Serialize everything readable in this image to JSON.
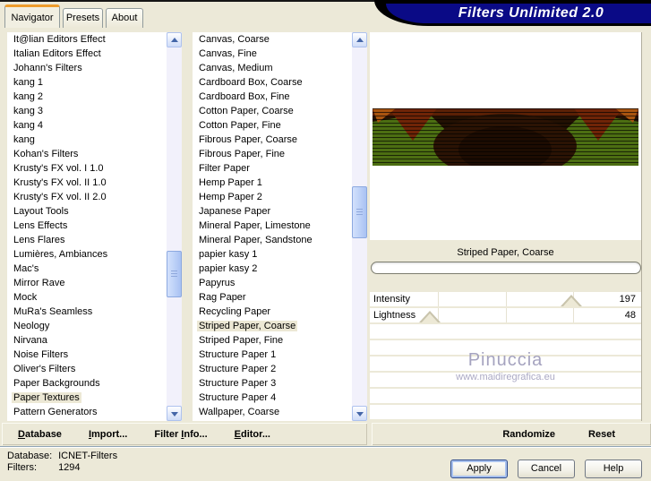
{
  "window": {
    "banner_title": "Filters Unlimited 2.0"
  },
  "tabs": [
    {
      "label": "Navigator",
      "active": true
    },
    {
      "label": "Presets",
      "active": false
    },
    {
      "label": "About",
      "active": false
    }
  ],
  "category_list": {
    "selected": "Paper Textures",
    "items": [
      "It@lian Editors Effect",
      "Italian Editors Effect",
      "Johann's Filters",
      "kang 1",
      "kang 2",
      "kang 3",
      "kang 4",
      "kang",
      "Kohan's Filters",
      "Krusty's FX vol. I 1.0",
      "Krusty's FX vol. II 1.0",
      "Krusty's FX vol. II 2.0",
      "Layout Tools",
      "Lens Effects",
      "Lens Flares",
      "Lumières, Ambiances",
      "Mac's",
      "Mirror Rave",
      "Mock",
      "MuRa's Seamless",
      "Neology",
      "Nirvana",
      "Noise Filters",
      "Oliver's Filters",
      "Paper Backgrounds",
      "Paper Textures",
      "Pattern Generators"
    ]
  },
  "filter_list": {
    "selected": "Striped Paper, Coarse",
    "items": [
      "Canvas, Coarse",
      "Canvas, Fine",
      "Canvas, Medium",
      "Cardboard Box, Coarse",
      "Cardboard Box, Fine",
      "Cotton Paper, Coarse",
      "Cotton Paper, Fine",
      "Fibrous Paper, Coarse",
      "Fibrous Paper, Fine",
      "Filter Paper",
      "Hemp Paper 1",
      "Hemp Paper 2",
      "Japanese Paper",
      "Mineral Paper, Limestone",
      "Mineral Paper, Sandstone",
      "papier kasy 1",
      "papier kasy 2",
      "Papyrus",
      "Rag Paper",
      "Recycling Paper",
      "Striped Paper, Coarse",
      "Striped Paper, Fine",
      "Structure Paper 1",
      "Structure Paper 2",
      "Structure Paper 3",
      "Structure Paper 4",
      "Wallpaper, Coarse"
    ]
  },
  "preview": {
    "caption": "Striped Paper, Coarse"
  },
  "sliders": {
    "max": 255,
    "items": [
      {
        "label": "Intensity",
        "value": 197
      },
      {
        "label": "Lightness",
        "value": 48
      }
    ]
  },
  "watermark": {
    "line1": "Pinuccia",
    "line2": "www.maidiregrafica.eu"
  },
  "toolbar_left": [
    {
      "label": "Database",
      "accel": "D"
    },
    {
      "label": "Import...",
      "accel": "I"
    },
    {
      "label": "Filter Info...",
      "accel": "I"
    },
    {
      "label": "Editor...",
      "accel": "E"
    }
  ],
  "toolbar_right": [
    {
      "label": "Randomize",
      "accel": null
    },
    {
      "label": "Reset",
      "accel": null
    }
  ],
  "status": {
    "database_label": "Database:",
    "database_value": "ICNET-Filters",
    "filters_label": "Filters:",
    "filters_value": "1294"
  },
  "action_buttons": [
    {
      "label": "Apply",
      "focused": true
    },
    {
      "label": "Cancel",
      "focused": false
    },
    {
      "label": "Help",
      "focused": false
    }
  ],
  "icons": {
    "scroll_up_icon": "triangle-up",
    "scroll_down_icon": "triangle-down",
    "slider_thumb_icon": "triangle-up"
  },
  "colors": {
    "window_bg": "#ECE9D8",
    "banner_navy": "#0A0A86",
    "tab_accent_orange": "#EE9C2C",
    "selection_bg": "#ECE8D5",
    "scrollbar_blue": "#A9C2F3",
    "watermark_gray": "#A5A3BF"
  }
}
